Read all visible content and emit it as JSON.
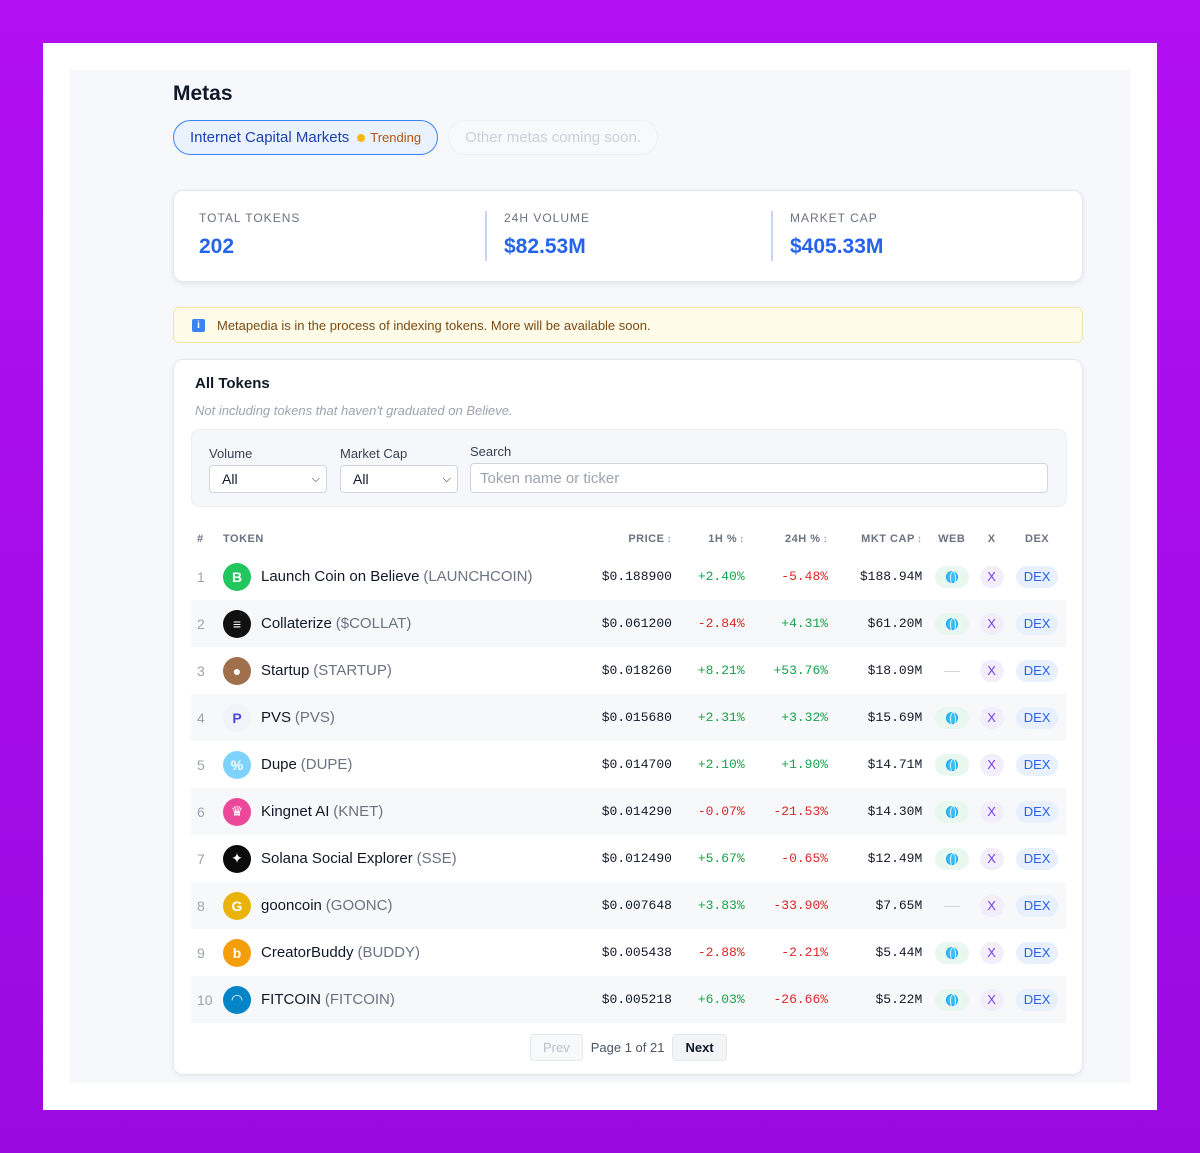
{
  "page": {
    "title": "Metas"
  },
  "meta_tabs": {
    "active": {
      "label": "Internet Capital Markets",
      "badge": "Trending",
      "badge_color": "#f5b90b"
    },
    "soon": {
      "label": "Other metas coming soon."
    }
  },
  "stats": [
    {
      "label": "TOTAL TOKENS",
      "value": "202"
    },
    {
      "label": "24H VOLUME",
      "value": "$82.53M"
    },
    {
      "label": "MARKET CAP",
      "value": "$405.33M"
    }
  ],
  "notice": {
    "icon": "info-icon",
    "text": "Metapedia is in the process of indexing tokens. More will be available soon."
  },
  "tokens": {
    "title": "All Tokens",
    "subtitle": "Not including tokens that haven't graduated on Believe.",
    "filters": {
      "volume": {
        "label": "Volume",
        "value": "All"
      },
      "market_cap": {
        "label": "Market Cap",
        "value": "All"
      },
      "search": {
        "label": "Search",
        "placeholder": "Token name or ticker"
      }
    },
    "columns": {
      "num": "#",
      "token": "TOKEN",
      "price": "PRICE",
      "h1": "1H %",
      "h24": "24H %",
      "mcap": "MKT CAP",
      "web": "WEB",
      "x": "X",
      "dex": "DEX",
      "sort_icon": "↕"
    },
    "rows": [
      {
        "num": "1",
        "name": "Launch Coin on Believe",
        "ticker": "(LAUNCHCOIN)",
        "price": "$0.188900",
        "h1": "+2.40%",
        "h24": "-5.48%",
        "mcap": "$188.94M",
        "web": true,
        "logo_color": "#22c55e",
        "logo_glyph": "B"
      },
      {
        "num": "2",
        "name": "Collaterize",
        "ticker": "($COLLAT)",
        "price": "$0.061200",
        "h1": "-2.84%",
        "h24": "+4.31%",
        "mcap": "$61.20M",
        "web": true,
        "logo_color": "#111111",
        "logo_glyph": "≡"
      },
      {
        "num": "3",
        "name": "Startup",
        "ticker": "(STARTUP)",
        "price": "$0.018260",
        "h1": "+8.21%",
        "h24": "+53.76%",
        "mcap": "$18.09M",
        "web": false,
        "logo_color": "#a0704c",
        "logo_glyph": "●"
      },
      {
        "num": "4",
        "name": "PVS",
        "ticker": "(PVS)",
        "price": "$0.015680",
        "h1": "+2.31%",
        "h24": "+3.32%",
        "mcap": "$15.69M",
        "web": true,
        "logo_color": "#f1f5f9",
        "logo_glyph": "P"
      },
      {
        "num": "5",
        "name": "Dupe",
        "ticker": "(DUPE)",
        "price": "$0.014700",
        "h1": "+2.10%",
        "h24": "+1.90%",
        "mcap": "$14.71M",
        "web": true,
        "logo_color": "#7dd3fc",
        "logo_glyph": "%"
      },
      {
        "num": "6",
        "name": "Kingnet AI",
        "ticker": "(KNET)",
        "price": "$0.014290",
        "h1": "-0.07%",
        "h24": "-21.53%",
        "mcap": "$14.30M",
        "web": true,
        "logo_color": "#ec4899",
        "logo_glyph": "♛"
      },
      {
        "num": "7",
        "name": "Solana Social Explorer",
        "ticker": "(SSE)",
        "price": "$0.012490",
        "h1": "+5.67%",
        "h24": "-0.65%",
        "mcap": "$12.49M",
        "web": true,
        "logo_color": "#0b0b0b",
        "logo_glyph": "✦"
      },
      {
        "num": "8",
        "name": "gooncoin",
        "ticker": "(GOONC)",
        "price": "$0.007648",
        "h1": "+3.83%",
        "h24": "-33.90%",
        "mcap": "$7.65M",
        "web": false,
        "logo_color": "#eab308",
        "logo_glyph": "G"
      },
      {
        "num": "9",
        "name": "CreatorBuddy",
        "ticker": "(BUDDY)",
        "price": "$0.005438",
        "h1": "-2.88%",
        "h24": "-2.21%",
        "mcap": "$5.44M",
        "web": true,
        "logo_color": "#f59e0b",
        "logo_glyph": "b"
      },
      {
        "num": "10",
        "name": "FITCOIN",
        "ticker": "(FITCOIN)",
        "price": "$0.005218",
        "h1": "+6.03%",
        "h24": "-26.66%",
        "mcap": "$5.22M",
        "web": true,
        "logo_color": "#0284c7",
        "logo_glyph": "◠"
      }
    ],
    "x_label": "X",
    "dex_label": "DEX"
  },
  "pagination": {
    "prev": "Prev",
    "text": "Page 1 of 21",
    "next": "Next"
  },
  "colors": {
    "accent": "#2563eb",
    "positive": "#16a34a",
    "negative": "#dc2626",
    "background": "#b20ff2"
  }
}
